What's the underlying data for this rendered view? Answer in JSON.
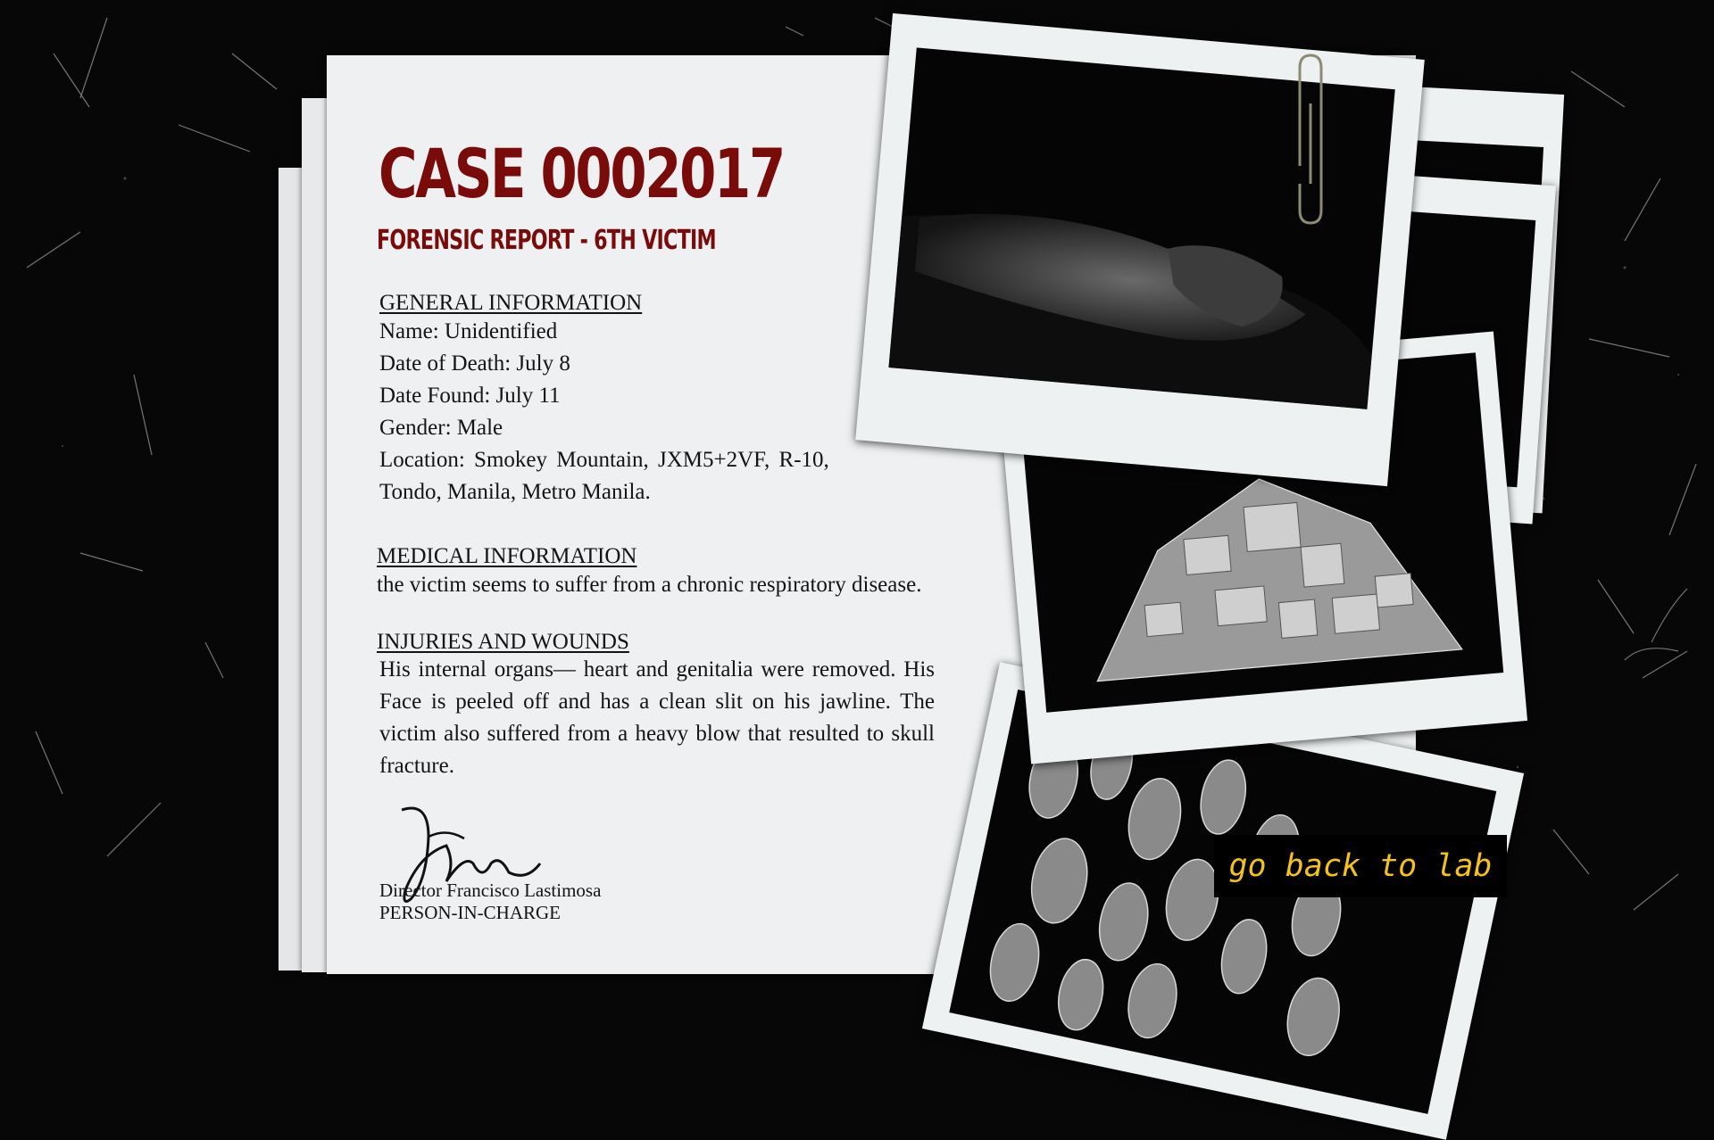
{
  "document": {
    "case_title": "CASE 0002017",
    "subtitle": "FORENSIC REPORT - 6TH VICTIM",
    "general": {
      "heading": "GENERAL INFORMATION",
      "name": "Name: Unidentified",
      "date_of_death": "Date of Death: July 8",
      "date_found": "Date Found: July 11",
      "gender": "Gender: Male",
      "location_line1": "Location:  Smokey  Mountain,  JXM5+2VF,  R-10,",
      "location_line2": "Tondo, Manila, Metro Manila."
    },
    "medical": {
      "heading": "MEDICAL INFORMATION",
      "text": "the victim seems to suffer from a chronic respiratory disease."
    },
    "injuries": {
      "heading": "INJURIES AND WOUNDS",
      "text": "His internal organs— heart and genitalia were removed. His Face is peeled off and has a clean slit on his jawline. The victim also suffered from a heavy blow that resulted to skull fracture."
    },
    "signature": {
      "name": "Director Francisco Lastimosa",
      "role": "PERSON-IN-CHARGE"
    }
  },
  "photos": {
    "photo1": "body-photo",
    "photo2": "debris-pile-photo",
    "photo3": "cans-pile-photo"
  },
  "actions": {
    "go_back_label": "go back to lab"
  },
  "colors": {
    "title_red": "#7a0b0b",
    "button_text": "#f4c21b",
    "background": "#070707"
  }
}
